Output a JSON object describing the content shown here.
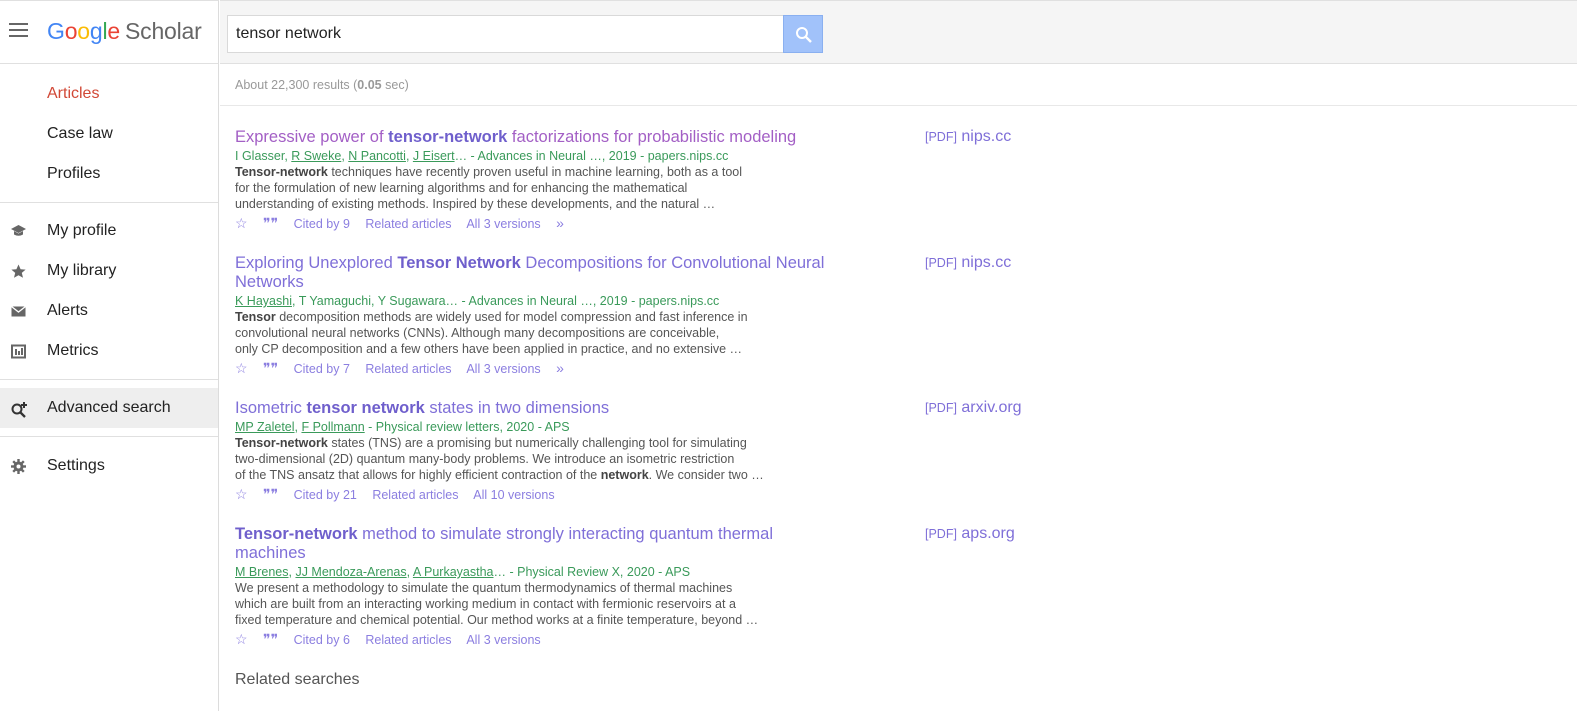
{
  "brand": {
    "g": "G",
    "o1": "o",
    "o2": "o",
    "g2": "g",
    "l": "l",
    "e": "e",
    "scholar": "Scholar"
  },
  "sidebar": {
    "items": [
      {
        "label": "Articles",
        "icon": "",
        "active": true
      },
      {
        "label": "Case law",
        "icon": ""
      },
      {
        "label": "Profiles",
        "icon": ""
      },
      {
        "label": "My profile",
        "icon": "graduation-cap-icon"
      },
      {
        "label": "My library",
        "icon": "star-icon"
      },
      {
        "label": "Alerts",
        "icon": "envelope-icon"
      },
      {
        "label": "Metrics",
        "icon": "metrics-icon"
      },
      {
        "label": "Advanced search",
        "icon": "advanced-search-icon"
      },
      {
        "label": "Settings",
        "icon": "gear-icon"
      }
    ]
  },
  "search": {
    "value": "tensor network"
  },
  "stats": {
    "prefix": "About 22,300 results (",
    "time": "0.05",
    "suffix": " sec)"
  },
  "results": [
    {
      "title_parts": [
        "Expressive power of ",
        "tensor-network",
        " factorizations for probabilistic modeling"
      ],
      "meta_authors": [
        "I Glasser",
        "R Sweke",
        "N Pancotti",
        "J Eisert"
      ],
      "meta_tail": "… - Advances in Neural …, 2019 - papers.nips.cc",
      "snippet_lines": [
        "techniques have recently proven useful in machine learning, both as a tool",
        "for the formulation of new learning algorithms and for enhancing the mathematical",
        "understanding of existing methods. Inspired by these developments, and the natural …"
      ],
      "snippet_bold": "Tensor-network",
      "cited": "Cited by 9",
      "related": "Related articles",
      "versions": "All 3 versions",
      "pdf_tag": "[PDF]",
      "pdf_site": "nips.cc"
    },
    {
      "title_parts": [
        "Exploring Unexplored ",
        "Tensor Network",
        " Decompositions for Convolutional Neural Networks"
      ],
      "meta_authors": [
        "K Hayashi"
      ],
      "meta_tail": ", T Yamaguchi, Y Sugawara… - Advances in Neural …, 2019 - papers.nips.cc",
      "snippet_bold": "Tensor",
      "snippet_lines": [
        " decomposition methods are widely used for model compression and fast inference in",
        "convolutional neural networks (CNNs). Although many decompositions are conceivable,",
        "only CP decomposition and a few others have been applied in practice, and no extensive …"
      ],
      "cited": "Cited by 7",
      "related": "Related articles",
      "versions": "All 3 versions",
      "pdf_tag": "[PDF]",
      "pdf_site": "nips.cc"
    },
    {
      "title_parts": [
        "Isometric ",
        "tensor network",
        " states in two dimensions"
      ],
      "meta_authors": [
        "MP Zaletel",
        "F Pollmann"
      ],
      "meta_tail": " - Physical review letters, 2020 - APS",
      "snippet_bold": "Tensor-network",
      "snippet_lines": [
        " states (TNS) are a promising but numerically challenging tool for simulating",
        "two-dimensional (2D) quantum many-body problems. We introduce an isometric restriction",
        "of the TNS ansatz that allows for highly efficient contraction of the "
      ],
      "snippet_bold2": "network",
      "snippet_end": ". We consider two …",
      "cited": "Cited by 21",
      "related": "Related articles",
      "versions": "All 10 versions",
      "pdf_tag": "[PDF]",
      "pdf_site": "arxiv.org"
    },
    {
      "title_parts": [
        "Tensor-network",
        " method to simulate strongly interacting quantum thermal machines"
      ],
      "meta_authors": [
        "M Brenes",
        "JJ Mendoza-Arenas",
        "A Purkayastha"
      ],
      "meta_tail": "… - Physical Review X, 2020 - APS",
      "snippet_lines": [
        "We present a methodology to simulate the quantum thermodynamics of thermal machines",
        "which are built from an interacting working medium in contact with fermionic reservoirs at a",
        "fixed temperature and chemical potential. Our method works at a finite temperature, beyond …"
      ],
      "cited": "Cited by 6",
      "related": "Related articles",
      "versions": "All 3 versions",
      "pdf_tag": "[PDF]",
      "pdf_site": "aps.org"
    }
  ],
  "related_searches": {
    "heading": "Related searches"
  }
}
